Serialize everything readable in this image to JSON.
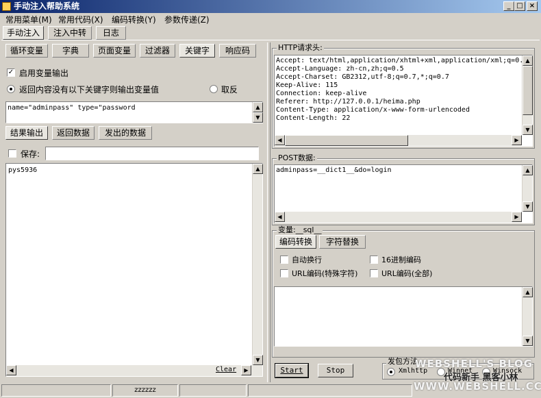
{
  "window": {
    "title": "手动注入帮助系统",
    "min": "_",
    "max": "□",
    "close": "×"
  },
  "menu": [
    "常用菜单(M)",
    "常用代码(X)",
    "编码转换(Y)",
    "参数传递(Z)"
  ],
  "top_tabs": [
    "手动注入",
    "注入中转",
    "日志"
  ],
  "sub_tabs": [
    "循环变量",
    "字典",
    "页面变量",
    "过滤器",
    "关键字",
    "响应码"
  ],
  "options": {
    "enable_var_output": "启用变量输出",
    "radio_no_keyword": "返回内容没有以下关键字则输出变量值",
    "radio_invert": "取反"
  },
  "keyword_text": "name=\"adminpass\" type=\"password",
  "result_tabs": [
    "结果输出",
    "返回数据",
    "发出的数据"
  ],
  "save": {
    "label": "保存:",
    "value": ""
  },
  "result_text": "pys5936",
  "clear_label": "Clear",
  "http_group": {
    "label": "HTTP请求头:",
    "lines": [
      "Accept: text/html,application/xhtml+xml,application/xml;q=0.",
      "Accept-Language: zh-cn,zh;q=0.5",
      "Accept-Charset: GB2312,utf-8;q=0.7,*;q=0.7",
      "Keep-Alive: 115",
      "Connection: keep-alive",
      "Referer: http://127.0.0.1/heima.php",
      "Content-Type: application/x-www-form-urlencoded",
      "Content-Length: 22"
    ]
  },
  "post_group": {
    "label": "POST数据:",
    "text": "adminpass=__dict1__&do=login"
  },
  "var_group": {
    "label": "变量:__sql__"
  },
  "encode_tabs": [
    "编码转换",
    "字符替换"
  ],
  "encode_options": [
    "自动换行",
    "16进制编码",
    "URL编码(特殊字符)",
    "URL编码(全部)"
  ],
  "buttons": {
    "start": "Start",
    "stop": "Stop"
  },
  "send_method": {
    "label": "发包方法",
    "options": [
      "Xmlhttp",
      "Winnet",
      "Winsock"
    ]
  },
  "status": {
    "cell2": "zzzzzz"
  },
  "watermark": {
    "line1": "WEBSHELL'S BLOG",
    "line2": "代码新手 黑客小林",
    "line3": "WWW.WEBSHELL.CC"
  }
}
